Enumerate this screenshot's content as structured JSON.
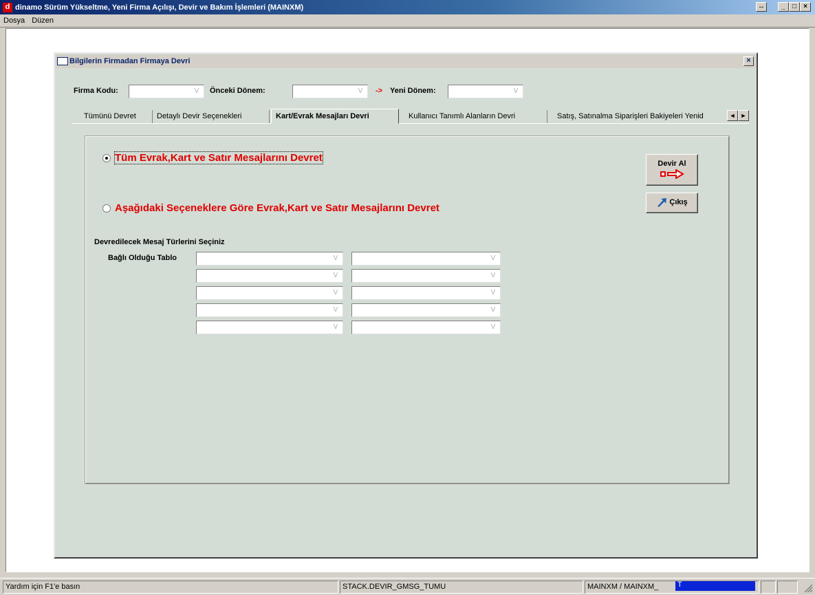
{
  "app": {
    "title": "dinamo Sürüm Yükseltme, Yeni Firma Açılışı, Devir ve Bakım İşlemleri (MAINXM)",
    "icon_letter": "d"
  },
  "window_buttons": {
    "restore": "↔",
    "minimize": "_",
    "maximize": "□",
    "close": "×"
  },
  "menu": [
    {
      "label": "Dosya"
    },
    {
      "label": "Düzen"
    }
  ],
  "dialog": {
    "title": "Bilgilerin Firmadan Firmaya Devri",
    "close": "×",
    "fields": {
      "firma_kodu_label": "Firma Kodu:",
      "onceki_donem_label": "Önceki Dönem:",
      "arrow": "->",
      "yeni_donem_label": "Yeni Dönem:",
      "firma_kodu_value": "",
      "onceki_donem_value": "",
      "yeni_donem_value": ""
    },
    "tabs": [
      {
        "label": "Tümünü Devret"
      },
      {
        "label": "Detaylı Devir Seçenekleri"
      },
      {
        "label": "Kart/Evrak Mesajları Devri"
      },
      {
        "label": "Kullanıcı Tanımlı Alanların Devri"
      },
      {
        "label": "Satış, Satınalma Siparişleri Bakiyeleri Yenid"
      }
    ],
    "active_tab": 2,
    "tab_scroll": {
      "left": "◄",
      "right": "►"
    },
    "panel": {
      "radio1": "Tüm Evrak,Kart ve Satır Mesajlarını Devret",
      "radio2": "Aşağıdaki Seçeneklere Göre Evrak,Kart ve Satır Mesajlarını Devret",
      "selected_radio": 1,
      "section_title": "Devredilecek Mesaj Türlerini Seçiniz",
      "table_label": "Bağlı Olduğu Tablo",
      "combo_rows": 5,
      "devir_al_button": "Devir Al",
      "cikis_button": "Çıkış"
    }
  },
  "statusbar": {
    "help": "Yardım için F1'e basın",
    "stack": "STACK.DEVIR_GMSG_TUMU",
    "user": "MAINXM / MAINXM_",
    "progress_text": "T"
  },
  "colors": {
    "accent_red": "#e00000",
    "titlebar": "#0a246a",
    "panel_bg": "#d4ddd5"
  }
}
